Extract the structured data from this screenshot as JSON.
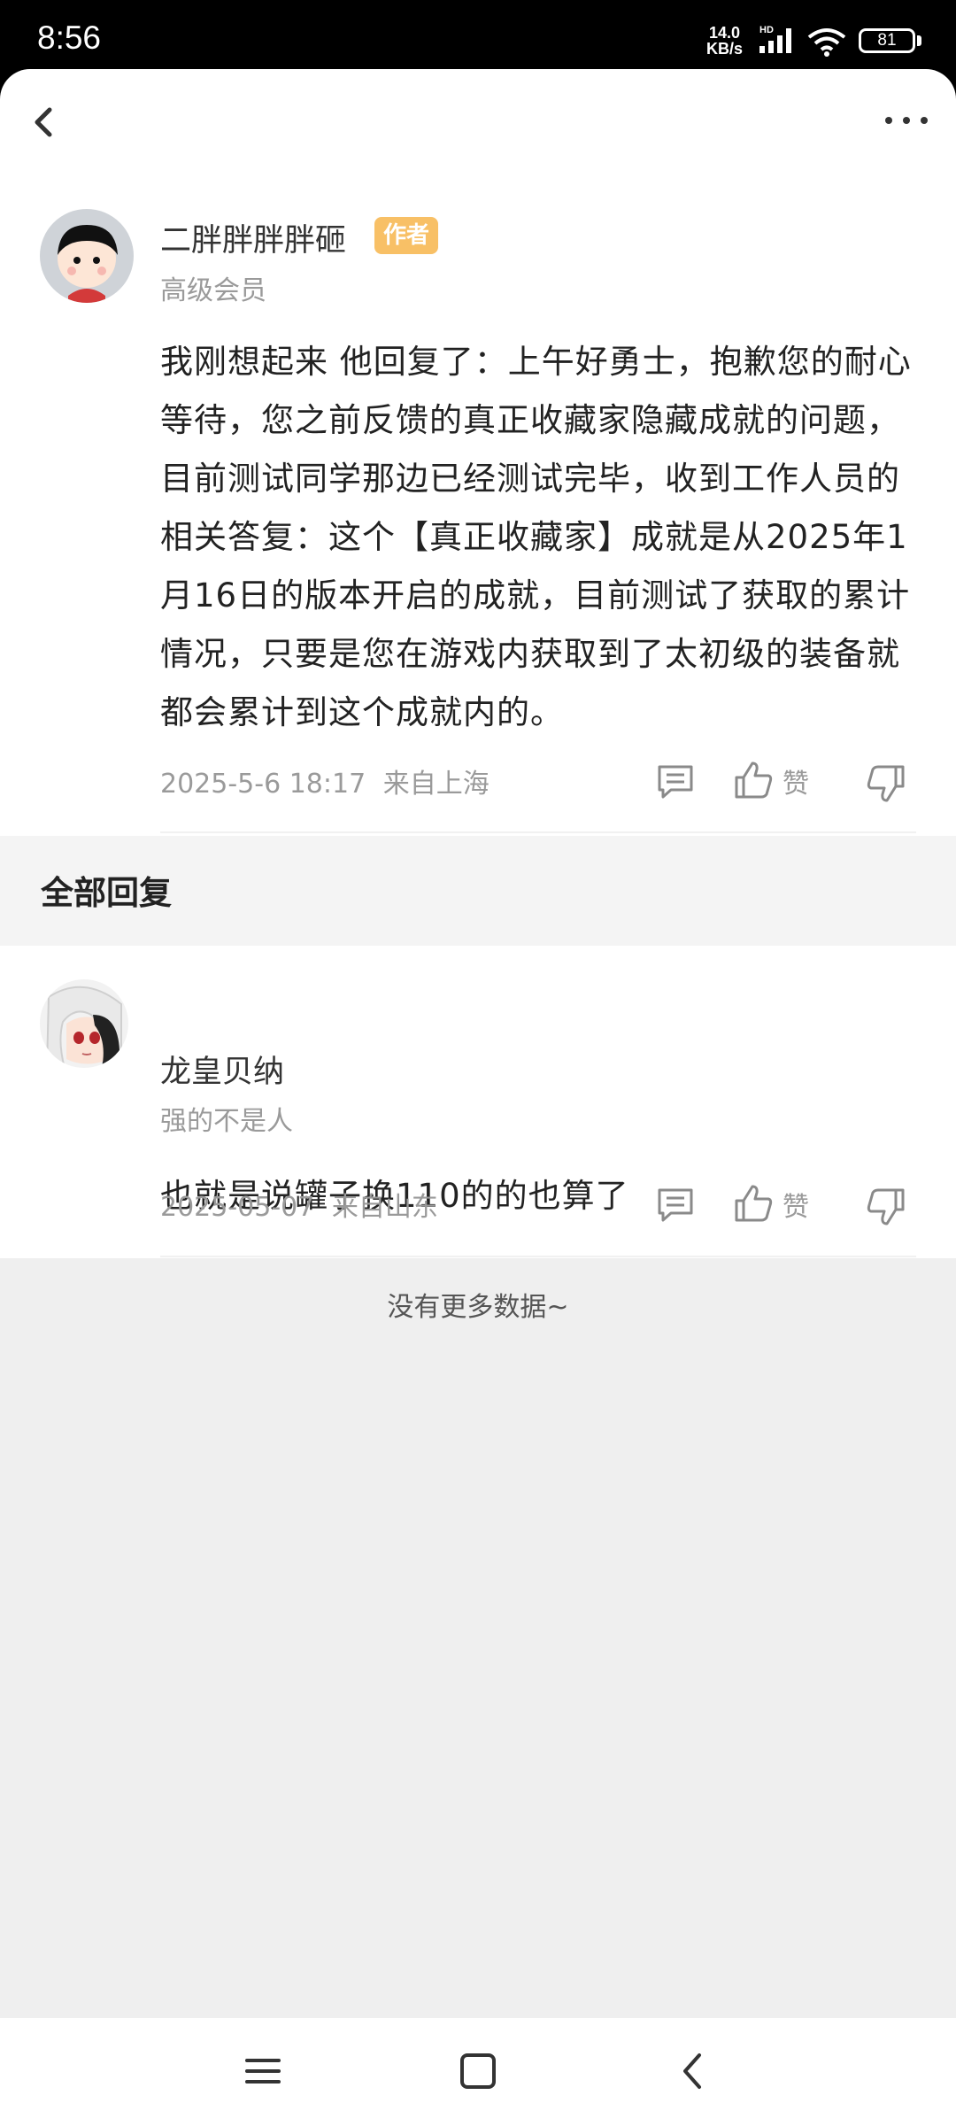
{
  "status_bar": {
    "time": "8:56",
    "net_speed_value": "14.0",
    "net_speed_unit": "KB/s",
    "network_type": "HD",
    "battery_level": "81"
  },
  "top_bar": {
    "back_icon": "chevron-left-icon",
    "more_icon": "more-horizontal-icon"
  },
  "main_comment": {
    "author": "二胖胖胖胖砸",
    "author_tag": "作者",
    "member_level": "高级会员",
    "body": "我刚想起来 他回复了：上午好勇士，抱歉您的耐心等待，您之前反馈的真正收藏家隐藏成就的问题，目前测试同学那边已经测试完毕，收到工作人员的相关答复：这个【真正收藏家】成就是从2025年1月16日的版本开启的成就，目前测试了获取的累计情况，只要是您在游戏内获取到了太初级的装备就都会累计到这个成就内的。",
    "date": "2025-5-6 18:17",
    "location": "来自上海",
    "like_label": "赞"
  },
  "replies_section": {
    "title": "全部回复"
  },
  "replies": [
    {
      "author": "龙皇贝纳",
      "signature": "强的不是人",
      "body": "也就是说罐子换110的的也算了",
      "date": "2025-05-07",
      "location": "来自山东",
      "like_label": "赞"
    }
  ],
  "footer": {
    "no_more": "没有更多数据~"
  },
  "colors": {
    "author_tag_bg": "#f8c066",
    "section_bg": "#f4f4f4",
    "empty_bg": "#efefef",
    "secondary_text": "#9a9a9a"
  }
}
